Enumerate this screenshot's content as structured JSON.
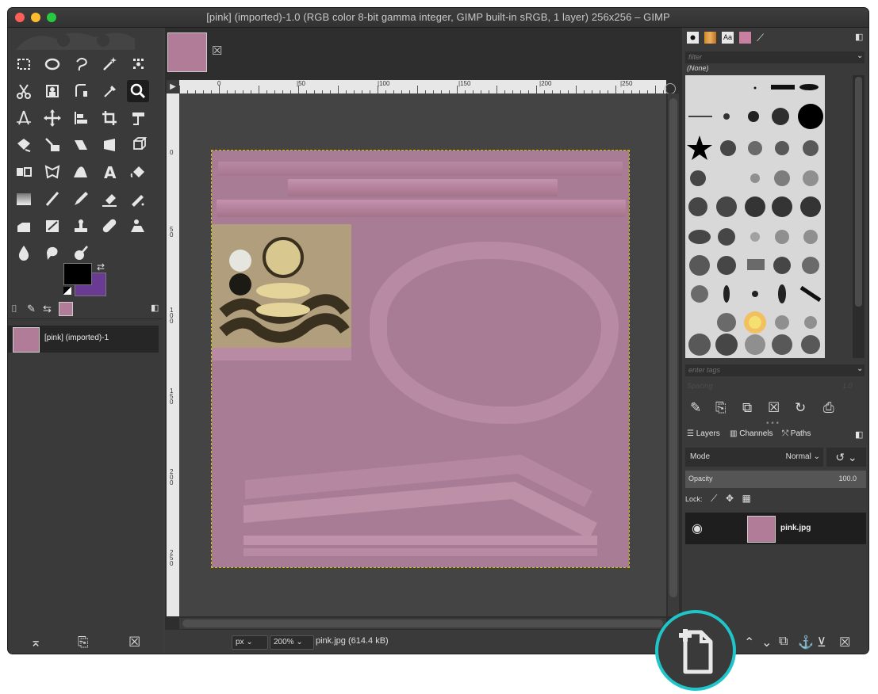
{
  "window": {
    "title": "[pink] (imported)-1.0 (RGB color 8-bit gamma integer, GIMP built-in sRGB, 1 layer) 256x256 – GIMP"
  },
  "toolbox": {
    "tools": [
      "rect-select",
      "ellipse-select",
      "free-select",
      "fuzzy-select",
      "by-color-select",
      "scissors-select",
      "foreground-select",
      "paths",
      "color-picker",
      "zoom",
      "measure",
      "move",
      "align",
      "crop",
      "unified-transform",
      "rotate",
      "scale",
      "shear",
      "perspective",
      "3d-transform",
      "flip",
      "cage",
      "warp",
      "text",
      "bucket-fill",
      "gradient",
      "paintbrush",
      "pencil",
      "eraser",
      "airbrush",
      "ink",
      "mypaint",
      "clone",
      "heal",
      "perspective-clone",
      "blur",
      "smudge",
      "dodge"
    ],
    "active_tool": "zoom",
    "fg_color": "#000000",
    "bg_color": "#6a3b93",
    "dock_tabs": [
      "tool-options",
      "device-status",
      "undo-history",
      "images"
    ],
    "images": [
      {
        "label": "[pink] (imported)-1"
      }
    ],
    "bottom_actions": [
      "raise-view",
      "new-display",
      "delete-image"
    ]
  },
  "canvas": {
    "tab_close": "☒",
    "ruler_labels_h": [
      "0",
      "|50",
      "|100",
      "|150",
      "|200",
      "|250"
    ],
    "ruler_labels_v": [
      "0",
      "5\n0",
      "1\n0\n0",
      "1\n5\n0",
      "2\n0\n0",
      "2\n5\n0"
    ],
    "status": {
      "unit": "px",
      "zoom": "200%",
      "info": "pink.jpg (614.4 kB)"
    }
  },
  "brushes": {
    "filter_placeholder": "filter",
    "selected_label": "(None)",
    "tags_placeholder": "enter tags",
    "spacing_label": "Spacing",
    "spacing_value": "1.0"
  },
  "layers": {
    "tabs": [
      "Layers",
      "Channels",
      "Paths"
    ],
    "mode_label": "Mode",
    "mode_value": "Normal",
    "opacity_label": "Opacity",
    "opacity_value": "100.0",
    "lock_label": "Lock:",
    "items": [
      {
        "name": "pink.jpg",
        "visible": true
      }
    ]
  },
  "highlight": {
    "icon": "new-layer-icon",
    "color": "#20c5c9"
  }
}
